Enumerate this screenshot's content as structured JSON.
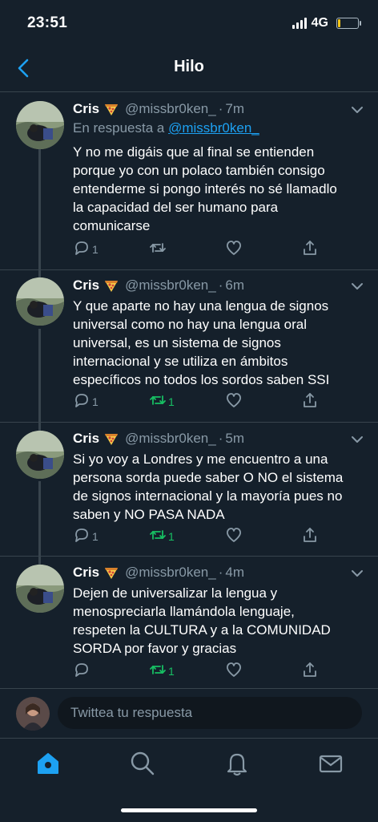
{
  "status": {
    "time": "23:51",
    "network": "4G",
    "battery_level": 0.15
  },
  "header": {
    "title": "Hilo",
    "back_icon": "back-arrow-icon"
  },
  "tweets": [
    {
      "name": "Cris",
      "emoji": "pizza",
      "handle": "@missbr0ken_",
      "sep": "·",
      "time": "7m",
      "reply_label": "En respuesta a",
      "reply_handle": "@missbr0ken_",
      "lines": [
        "Y no me digáis que al final se entienden",
        "porque yo con un polaco también consigo",
        "entenderme si pongo interés no sé llamadlo",
        "la capacidad del ser humano para",
        "comunicarse"
      ],
      "replies": "1",
      "retweets": ""
    },
    {
      "name": "Cris",
      "emoji": "pizza",
      "handle": "@missbr0ken_",
      "sep": "·",
      "time": "6m",
      "lines": [
        "Y que aparte no hay una lengua de signos",
        "universal como no hay una lengua oral",
        "universal, es un sistema de signos",
        "internacional y se utiliza en ámbitos",
        "específicos no todos los sordos saben SSI"
      ],
      "replies": "1",
      "retweets": "1"
    },
    {
      "name": "Cris",
      "emoji": "pizza",
      "handle": "@missbr0ken_",
      "sep": "·",
      "time": "5m",
      "lines": [
        "Si yo voy a Londres y me encuentro a una",
        "persona sorda puede saber O NO el sistema",
        "de signos internacional y la mayoría pues no",
        "saben y NO PASA NADA"
      ],
      "replies": "1",
      "retweets": "1"
    },
    {
      "name": "Cris",
      "emoji": "pizza",
      "handle": "@missbr0ken_",
      "sep": "·",
      "time": "4m",
      "lines": [
        "Dejen de universalizar la lengua y",
        "menospreciarla llamándola lenguaje,",
        "respeten la CULTURA y a la COMUNIDAD",
        "SORDA por favor y gracias"
      ],
      "replies": "",
      "retweets": "1"
    }
  ],
  "compose": {
    "placeholder": "Twittea tu respuesta"
  },
  "tabs": [
    "home-icon",
    "search-icon",
    "notifications-icon",
    "messages-icon"
  ],
  "colors": {
    "background": "#15202b",
    "accent": "#1da1f2",
    "retweet": "#17bf63",
    "muted": "#8899a6",
    "border": "#38444d"
  }
}
